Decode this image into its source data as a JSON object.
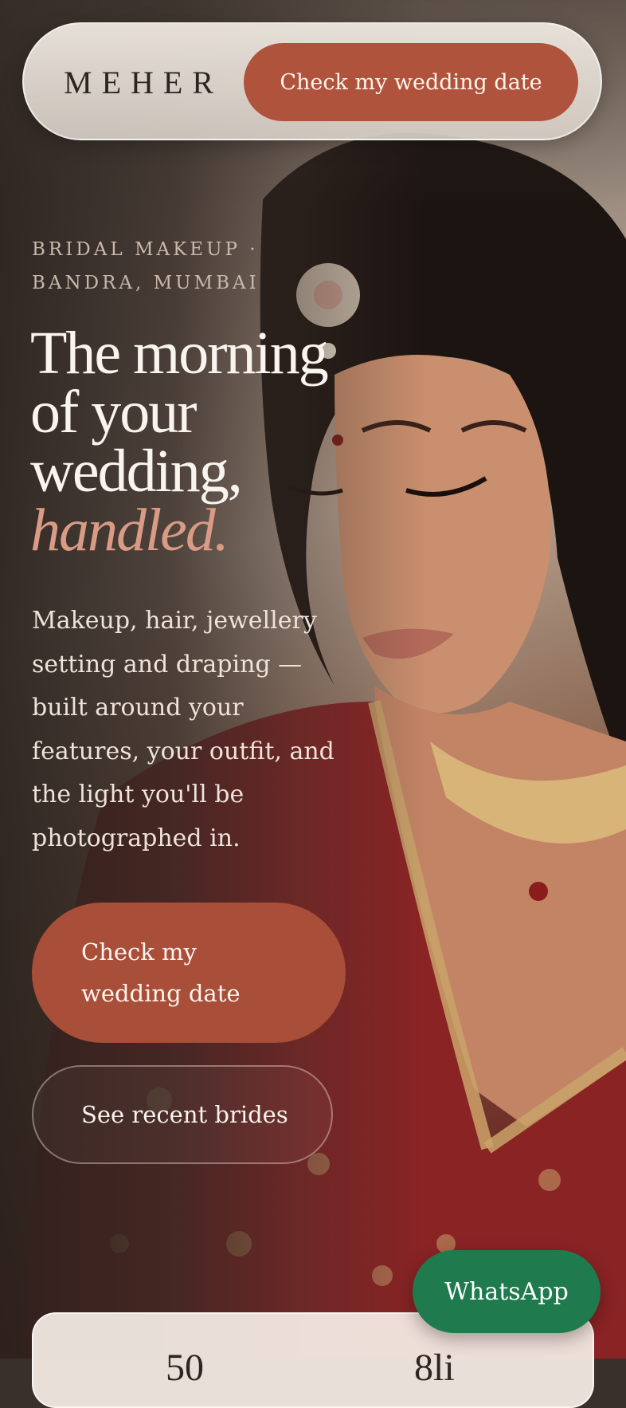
{
  "header": {
    "logo": "MEHER",
    "cta_label": "Check my wedding date"
  },
  "hero": {
    "eyebrow_line1": "BRIDAL MAKEUP ·",
    "eyebrow_line2": "BANDRA, MUMBAI",
    "headline_line1": "The morning",
    "headline_line2": "of your",
    "headline_line3": "wedding,",
    "headline_accent": "handled.",
    "body": "Makeup, hair, jewellery setting and draping — built around your features, your outfit, and the light you'll be photographed in.",
    "primary_cta": "Check my wedding date",
    "secondary_cta": "See recent brides"
  },
  "whatsapp_label": "WhatsApp",
  "stats": {
    "value_1": "50",
    "value_2": "8li"
  },
  "colors": {
    "accent": "#b0533c",
    "accent_italic": "#d99b85",
    "whatsapp_green": "#1f7a4d"
  }
}
